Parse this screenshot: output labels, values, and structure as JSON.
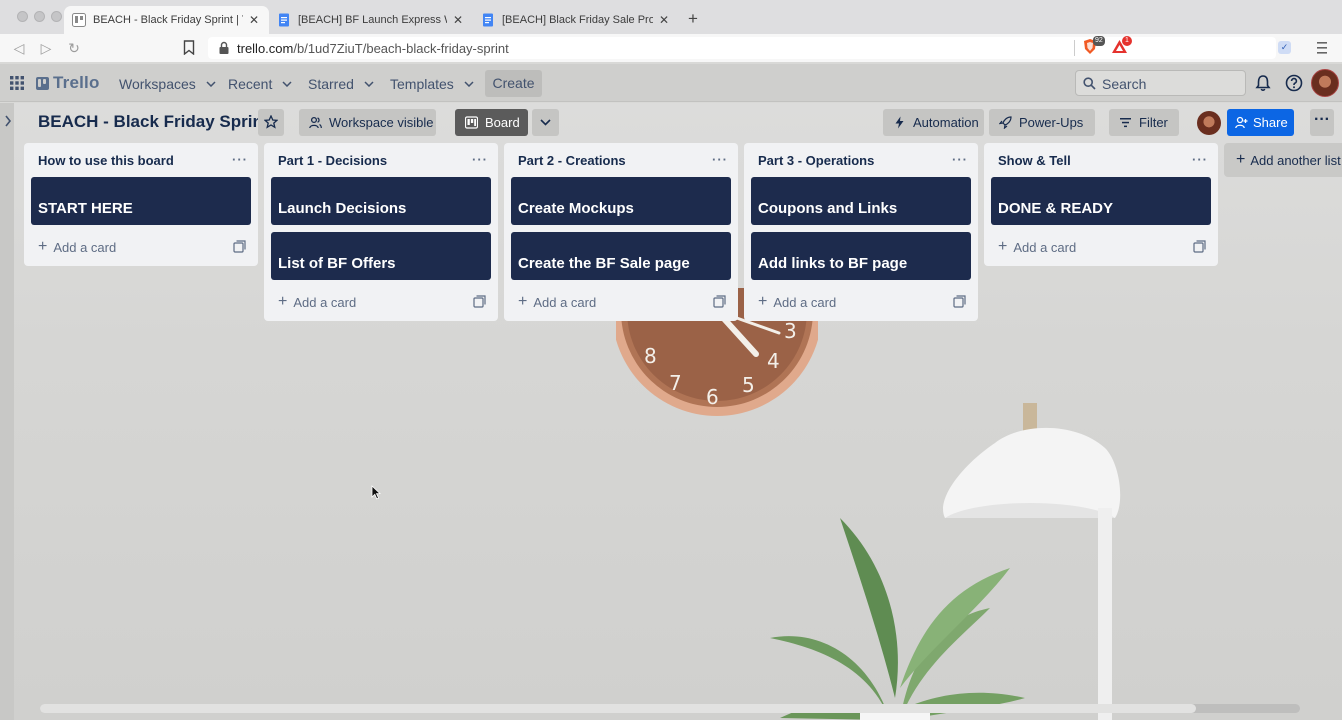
{
  "browser": {
    "tabs": [
      {
        "title": "BEACH - Black Friday Sprint | Tr",
        "active": true
      },
      {
        "title": "[BEACH] BF Launch Express Wo",
        "active": false
      },
      {
        "title": "[BEACH] Black Friday Sale Prod",
        "active": false
      }
    ],
    "url_host": "trello.com",
    "url_path": "/b/1ud7ZiuT/beach-black-friday-sprint",
    "brave_shield_count": "92",
    "rewards_count": "1"
  },
  "header": {
    "logo": "Trello",
    "menus": [
      "Workspaces",
      "Recent",
      "Starred",
      "Templates"
    ],
    "create_label": "Create",
    "search_placeholder": "Search"
  },
  "board": {
    "title": "BEACH - Black Friday Sprint",
    "visibility_label": "Workspace visible",
    "view_label": "Board",
    "automation_label": "Automation",
    "powerups_label": "Power-Ups",
    "filter_label": "Filter",
    "share_label": "Share",
    "add_list_label": "Add another list",
    "add_card_label": "Add a card",
    "lists": [
      {
        "name": "How to use this board",
        "cards": [
          "START HERE"
        ]
      },
      {
        "name": "Part 1 - Decisions",
        "cards": [
          "Launch Decisions",
          "List of BF Offers"
        ]
      },
      {
        "name": "Part 2 - Creations",
        "cards": [
          "Create Mockups",
          "Create the BF Sale page"
        ]
      },
      {
        "name": "Part 3 - Operations",
        "cards": [
          "Coupons and Links",
          "Add links to BF page"
        ]
      },
      {
        "name": "Show & Tell",
        "cards": [
          "DONE & READY"
        ]
      }
    ]
  },
  "colors": {
    "card_bg": "#1d2b4d",
    "share_bg": "#0c66e4",
    "list_bg": "#f1f2f4"
  }
}
